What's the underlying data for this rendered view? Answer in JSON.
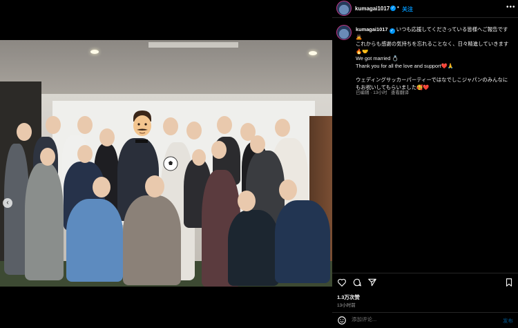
{
  "header": {
    "username": "kumagai1017",
    "separator": "•",
    "follow_label": "关注",
    "more_label": "•••"
  },
  "caption": {
    "username": "kumagai1017",
    "lines": [
      "いつも応援してくださっている皆様へご報告です",
      "これからも感謝の気持ちを忘れることなく、日々精進していきます",
      "We got married",
      "Thank you for all the love and support",
      "ウェディングサッカーパーティーではなでしこジャパンのみんなにもお祝いしてもらいました"
    ]
  },
  "meta": {
    "edited": "已编辑 · 13小时",
    "translate": "查看翻译"
  },
  "actions": {
    "likes": "1.3万次赞",
    "time": "13小时前"
  },
  "comment": {
    "placeholder": "添加评论...",
    "post_label": "发布"
  },
  "icons": [
    "heart-icon",
    "comment-icon",
    "share-icon",
    "bookmark-icon",
    "emoji-icon",
    "verified-icon",
    "more-icon",
    "prev-arrow-icon"
  ],
  "colors": {
    "accent": "#0095f6",
    "background": "#000000",
    "text": "#f5f5f5",
    "muted": "#a8a8a8"
  }
}
